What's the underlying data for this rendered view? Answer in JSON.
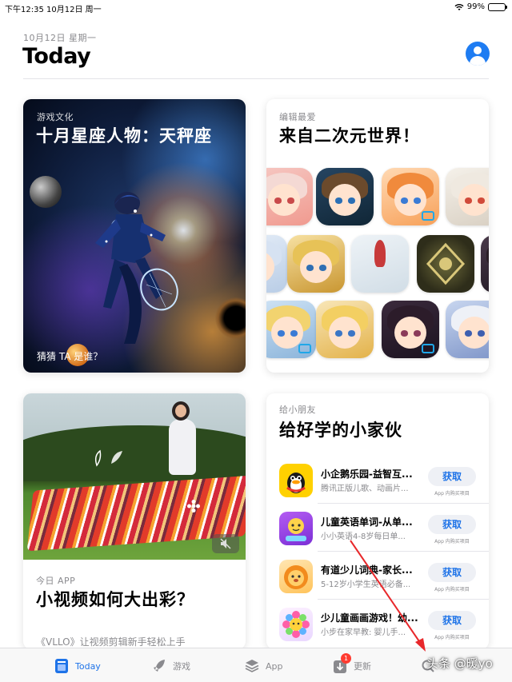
{
  "status_bar": {
    "time_date": "下午12:35  10月12日 周一",
    "battery": "99%",
    "battery_level": 0.99
  },
  "header": {
    "date": "10月12日 星期一",
    "title": "Today"
  },
  "cards": {
    "stars": {
      "eyebrow": "游戏文化",
      "title": "十月星座人物：天秤座",
      "caption": "猜猜 TA 是谁？"
    },
    "anime": {
      "eyebrow": "编辑最爱",
      "title": "来自二次元世界！"
    },
    "video": {
      "eyebrow": "今日 APP",
      "title": "小视频如何大出彩？",
      "desc": "《VLLO》让视频剪辑新手轻松上手"
    },
    "kids": {
      "eyebrow": "给小朋友",
      "title": "给好学的小家伙",
      "apps": [
        {
          "name": "小企鹅乐园-益智互...",
          "sub": "腾讯正版儿歌、动画片...",
          "button": "获取",
          "note": "App 内购买项目",
          "icon": "penguin-icon"
        },
        {
          "name": "儿童英语单词-从单...",
          "sub": "小小英语4-8岁每日单...",
          "button": "获取",
          "note": "App 内购买项目",
          "icon": "reading-icon"
        },
        {
          "name": "有道少儿词典-家长...",
          "sub": "5-12岁小学生英语必备...",
          "button": "获取",
          "note": "App 内购买项目",
          "icon": "lion-icon"
        },
        {
          "name": "少儿童画画游戏！幼...",
          "sub": "小步在家早教: 婴儿手...",
          "button": "获取",
          "note": "App 内购买项目",
          "icon": "sunflower-icon"
        }
      ]
    }
  },
  "tabbar": {
    "tabs": [
      {
        "label": "Today",
        "icon": "today-icon"
      },
      {
        "label": "游戏",
        "icon": "rocket-icon"
      },
      {
        "label": "App",
        "icon": "layers-icon"
      },
      {
        "label": "更新",
        "icon": "download-icon",
        "badge": "1"
      }
    ]
  },
  "watermark": "头条 @暖yo",
  "colors": {
    "accent": "#1e73e8",
    "badge": "#ff3b30",
    "annotation_arrow": "#e8282b"
  }
}
